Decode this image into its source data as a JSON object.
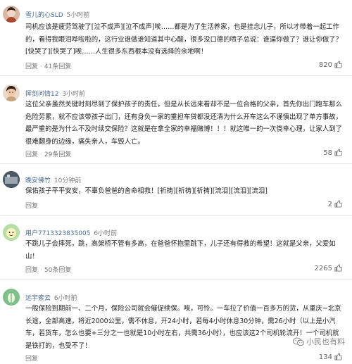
{
  "comments": [
    {
      "username": "雪儿的心SLD",
      "time": "5小时前",
      "text": "司机应该是疲劳驾驶了[泣不成声][泣不成声]唉……都是为了生活养家，也是挂念儿子，所以才带着一起工作的，看得我眼泪哗啦啦的，这行业谁做谁知道其中心酸，很多没口德的喷子总说：谁逼你做了？谁让你做了？[快哭了][快哭了]唉……人生很多东西根本没有选择的余地啊！",
      "reply_label": "回复",
      "reply_count": "41条回复",
      "likes": "820"
    },
    {
      "username": "挥剑问情12",
      "time": "3小时前",
      "text": "这位父亲虽然关键时刻尽到了保护孩子的责任，但是从长远来看却不是一位合格的父亲，首先你出门跑车那么危险劳累，就不应该带孩子出门，还有身负一家的重担车贷都没还清为什么开车这么不谨慎出现了单方事故，最严重的是为什么不及时续交保险？这就是在拿全家的幸福赌博！！！就这唯一的一次侥幸心理，让家人到了很难翻身的边缘，痛失亲人，车毁人亡。",
      "reply_label": "回复",
      "reply_count": "29条回复",
      "likes": "58"
    },
    {
      "username": "晚安佛竹",
      "time": "10分钟前",
      "text": "保佑孩子平平安安，不辜负爸爸的舍命相救！[祈祷][祈祷][祈祷][流泪][流泪][流泪]",
      "reply_label": "回复",
      "reply_count": "",
      "likes": "2"
    },
    {
      "username": "用户7713323835005",
      "time": "6小时前",
      "text": "不跳儿子会摔死，跳，高架桥不管有多高，在爸爸怀抱里跳下，儿子还有得救的希望！这就是父亲，父爱如山！",
      "reply_label": "回复",
      "reply_count": "50条回复",
      "likes": "2265"
    },
    {
      "username": "远宇索云",
      "time": "6小时前",
      "text": "一般保险到期前一、二个月，保险公司就会催促续保。唉，可怜。一车拉了价值一百多万的货，从重庆~北京长途，全部高速，将近2000公里，需不休息，开24小时，若每4小时休息30分钟，需26小时（以上是小汽车，若货车，怎么也要+三分之一也就是10小时左右，共需36小时），也应该这2个司机轮流开！一个司机就是铁打的，也受不了！",
      "reply_label": "回复",
      "reply_count": "",
      "likes": "134"
    }
  ],
  "watermark": "小民也有料"
}
